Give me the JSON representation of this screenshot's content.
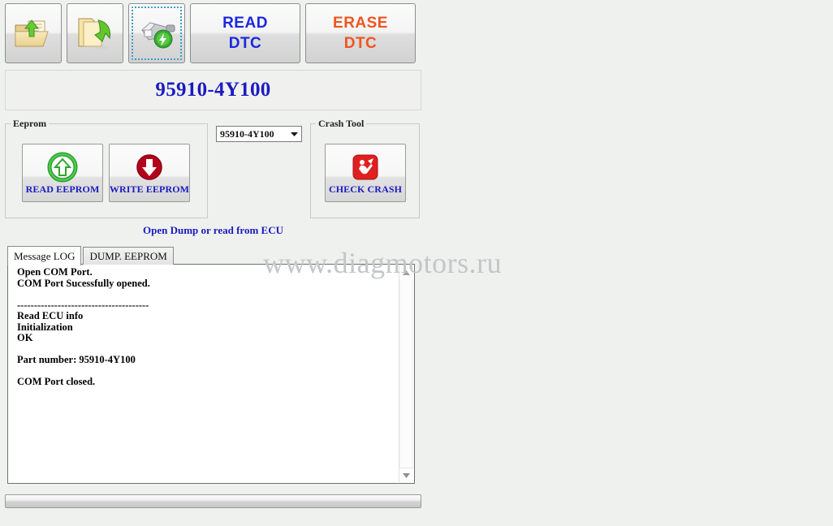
{
  "window": {
    "background_color": "#eff1ee",
    "watermark": "www.diagmotors.ru"
  },
  "toolbar": {
    "buttons": [
      {
        "name": "open-dump",
        "icon": "folder-open-up-arrow-icon",
        "label": ""
      },
      {
        "name": "save-dump",
        "icon": "folder-down-arrow-icon",
        "label": ""
      },
      {
        "name": "connect-ecu",
        "icon": "obd-connector-bolt-icon",
        "label": "",
        "focused": true
      },
      {
        "name": "read-dtc",
        "icon": "",
        "label_line1": "READ",
        "label_line2": "DTC",
        "color": "#1a28e0"
      },
      {
        "name": "erase-dtc",
        "icon": "",
        "label_line1": "ERASE",
        "label_line2": "DTC",
        "color": "#ef5520"
      }
    ]
  },
  "banner": {
    "part_number": "95910-4Y100",
    "color": "#1b1bc0"
  },
  "eeprom_group": {
    "title": "Eeprom",
    "read_button": {
      "label": "READ EEPROM",
      "icon": "green-circle-up-arrow-icon"
    },
    "write_button": {
      "label": "WRITE EEPROM",
      "icon": "red-circle-down-arrow-icon"
    }
  },
  "module_select": {
    "value": "95910-4Y100",
    "options": [
      "95910-4Y100"
    ]
  },
  "crash_group": {
    "title": "Crash Tool",
    "check_button": {
      "label": "CHECK CRASH",
      "icon": "crash-airbag-icon"
    }
  },
  "hint": {
    "text": "Open Dump or read from ECU",
    "color": "#1b1bc0"
  },
  "tabs": [
    {
      "label": "Message LOG",
      "active": true
    },
    {
      "label": "DUMP. EEPROM",
      "active": false
    }
  ],
  "log": {
    "lines": [
      "Open COM Port.",
      "COM Port Sucessfully opened.",
      "",
      "---------------------------------------",
      "Read ECU info",
      "Initialization",
      "OK",
      "",
      "Part number: 95910-4Y100",
      "",
      "COM Port closed."
    ]
  },
  "scrollbar": {
    "up_icon": "caret-up-icon",
    "down_icon": "caret-down-icon"
  },
  "statusbar": {
    "progress_percent": 0
  }
}
